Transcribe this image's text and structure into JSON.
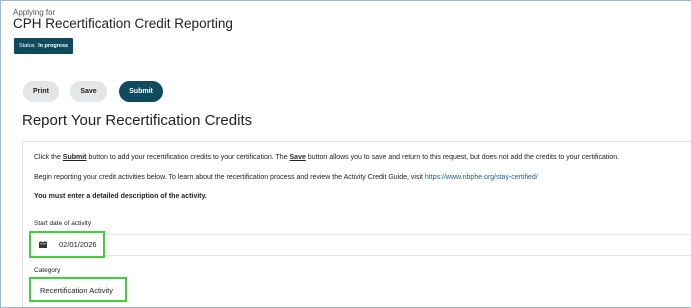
{
  "header": {
    "applying_for": "Applying for",
    "title": "CPH Recertification Credit Reporting",
    "status_label": "Status",
    "status_value": "In progress"
  },
  "toolbar": {
    "print_label": "Print",
    "save_label": "Save",
    "submit_label": "Submit"
  },
  "section": {
    "title": "Report Your Recertification Credits"
  },
  "instructions": {
    "line1_prefix": "Click the ",
    "line1_submit": "Submit",
    "line1_mid": " button to add your recertification credits to your certification. The ",
    "line1_save": "Save",
    "line1_suffix": " button allows you to save and return to this request, but does not add the credits to your certification.",
    "line2_prefix": "Begin reporting your credit activities below. To learn about the recertification process and review the Activity Credit Guide, visit ",
    "line2_link": "https://www.nbphe.org/stay-certified/",
    "line3": "You must enter a detailed description of the activity."
  },
  "form": {
    "start_date_label": "Start date of activity",
    "start_date_value": "02/01/2026",
    "start_date_icon": "calendar-icon",
    "category_label": "Category",
    "category_value": "Recertification Activity"
  },
  "colors": {
    "brand": "#0f4a5e",
    "highlight": "#3fd13b",
    "link": "#1b5e8a"
  }
}
